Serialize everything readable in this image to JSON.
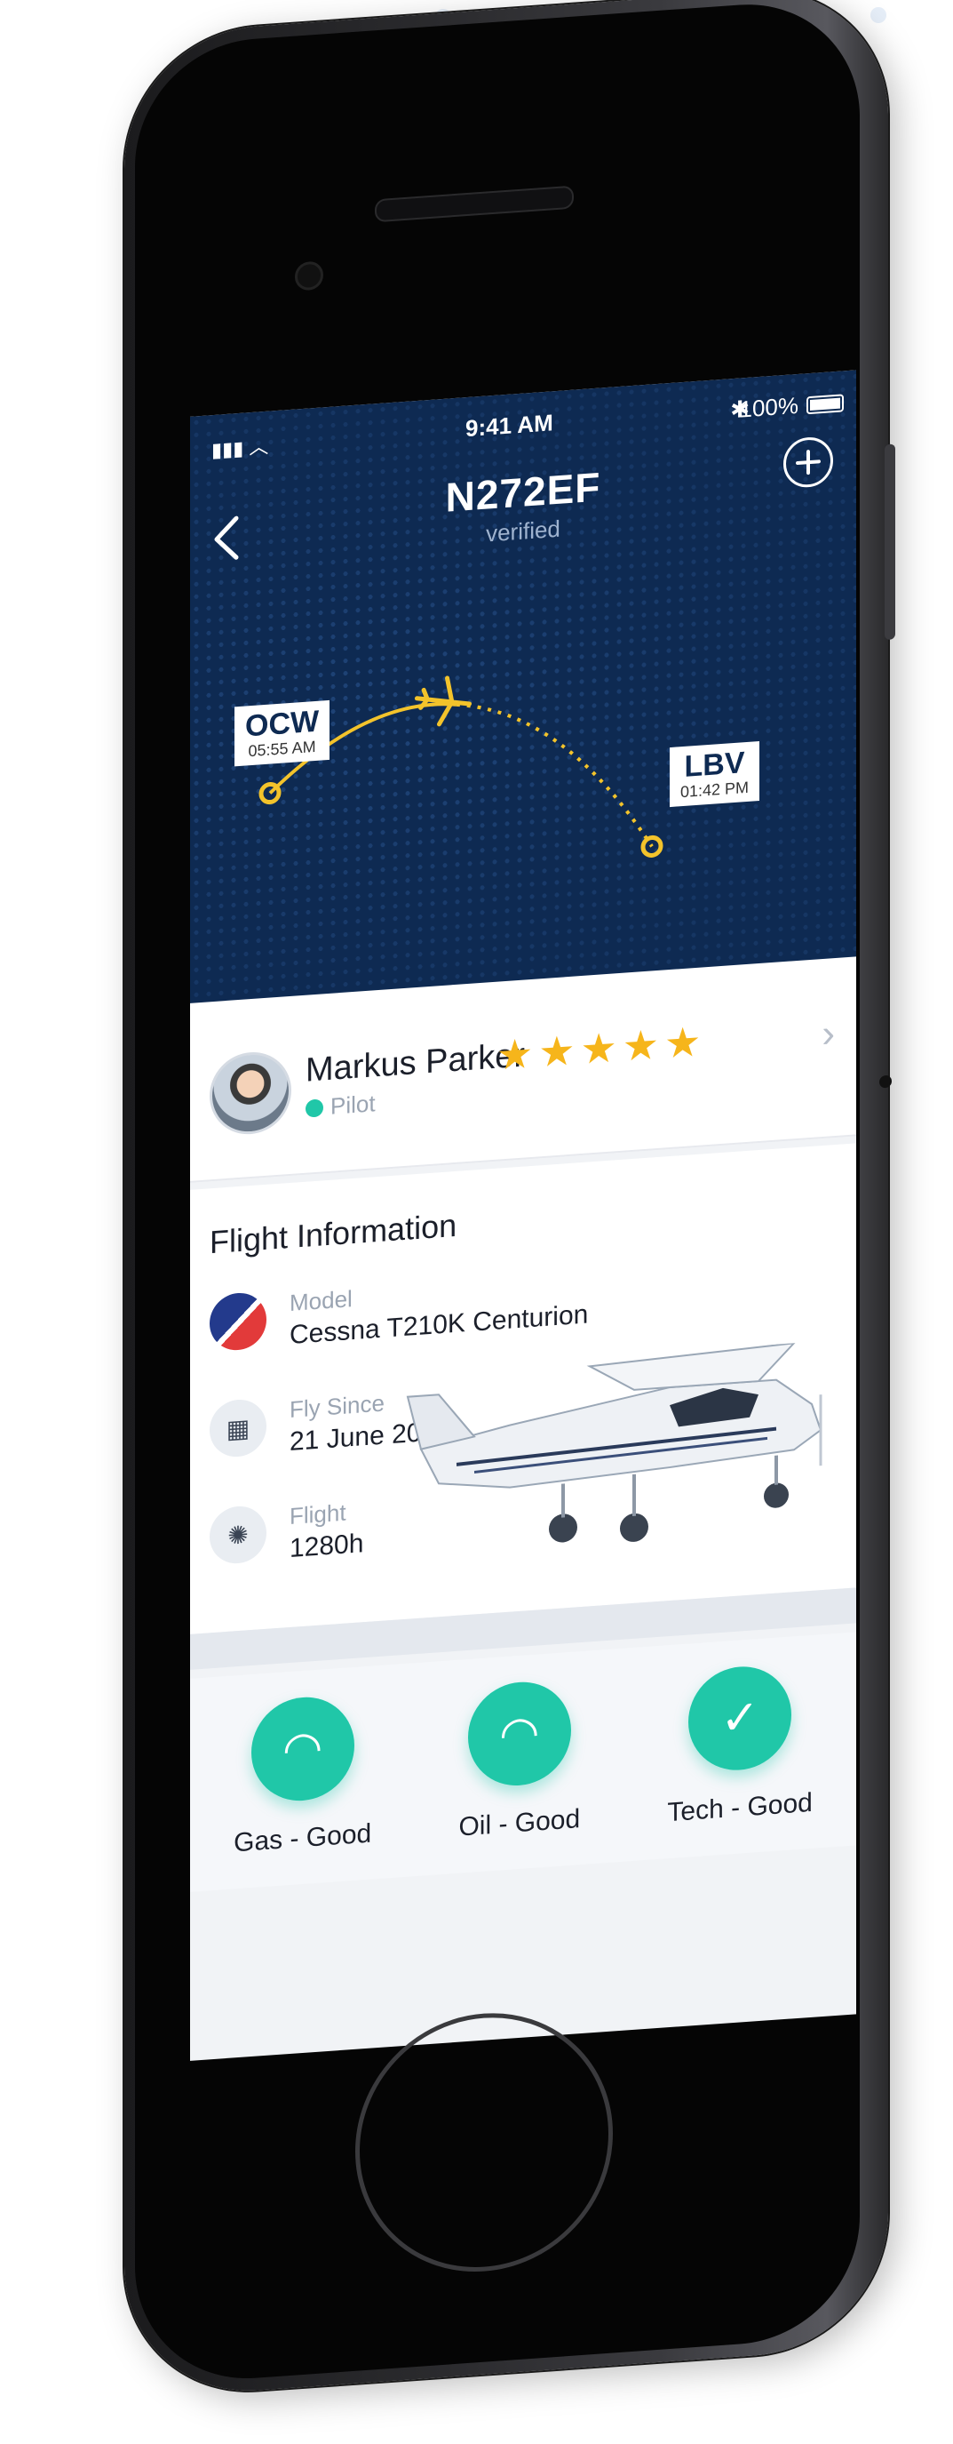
{
  "status_bar": {
    "time": "9:41 AM",
    "battery": "100%",
    "signal_icon": "signal-wifi-icon",
    "bluetooth_icon": "bluetooth-icon"
  },
  "header": {
    "title": "N272EF",
    "subtitle": "verified",
    "back_icon": "chevron-left-icon",
    "add_icon": "plus-circle-icon"
  },
  "route": {
    "origin": {
      "code": "OCW",
      "time": "05:55 AM"
    },
    "destination": {
      "code": "LBV",
      "time": "01:42 PM"
    }
  },
  "pilot": {
    "name": "Markus Parker",
    "role": "Pilot",
    "rating": 5,
    "max_rating": 5,
    "star_glyph": "★",
    "chevron": "›"
  },
  "flight_info": {
    "title": "Flight Information",
    "model": {
      "label": "Model",
      "value": "Cessna T210K Centurion"
    },
    "fly_since": {
      "label": "Fly Since",
      "value": "21 June 2016",
      "icon": "calendar-icon"
    },
    "flight": {
      "label": "Flight",
      "value": "1280h",
      "icon": "gauge-icon"
    }
  },
  "statuses": [
    {
      "label": "Gas - Good",
      "icon": "gauge-icon",
      "glyph": "◠"
    },
    {
      "label": "Oil - Good",
      "icon": "gauge-icon",
      "glyph": "◠"
    },
    {
      "label": "Tech - Good",
      "icon": "check-icon",
      "glyph": "✓"
    }
  ],
  "colors": {
    "map_bg": "#0e2a52",
    "accent_teal": "#20c7a8",
    "star_gold": "#f6b51b",
    "route_line": "#f3c32b"
  }
}
